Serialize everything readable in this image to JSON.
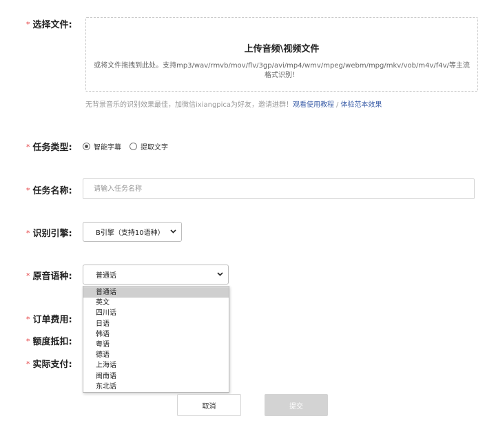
{
  "required_mark": "*",
  "labels": {
    "file": "选择文件:",
    "task_type": "任务类型:",
    "task_name": "任务名称:",
    "engine": "识别引擎:",
    "language": "原音语种:",
    "order_fee": "订单费用:",
    "credit": "额度抵扣:",
    "actual_pay": "实际支付:"
  },
  "upload": {
    "title": "上传音频\\视频文件",
    "description": "或将文件拖拽到此处。支持mp3/wav/rmvb/mov/flv/3gp/avi/mp4/wmv/mpeg/webm/mpg/mkv/vob/m4v/f4v/等主流格式识别！"
  },
  "tip": {
    "text": "无背景音乐的识别效果最佳，加微信ixiangpica为好友，邀请进群！",
    "tutorial_link": "观看使用教程",
    "separator": "/",
    "sample_link": "体验范本效果"
  },
  "task_type_options": [
    {
      "label": "智能字幕",
      "checked": true
    },
    {
      "label": "提取文字",
      "checked": false
    }
  ],
  "task_name": {
    "value": "",
    "placeholder": "请输入任务名称"
  },
  "engine_select": {
    "selected": "B引擎（支持10语种）",
    "icon": "chevron-down-icon"
  },
  "language_select": {
    "selected": "普通话",
    "icon": "chevron-down-icon",
    "options": [
      "普通话",
      "英文",
      "四川话",
      "日语",
      "韩语",
      "粤语",
      "德语",
      "上海话",
      "闽南语",
      "东北话"
    ]
  },
  "buttons": {
    "cancel": "取消",
    "submit": "提交"
  },
  "colors": {
    "required": "#e4393c",
    "link": "#3b5ea8",
    "submit_disabled": "#d3d3d3"
  }
}
